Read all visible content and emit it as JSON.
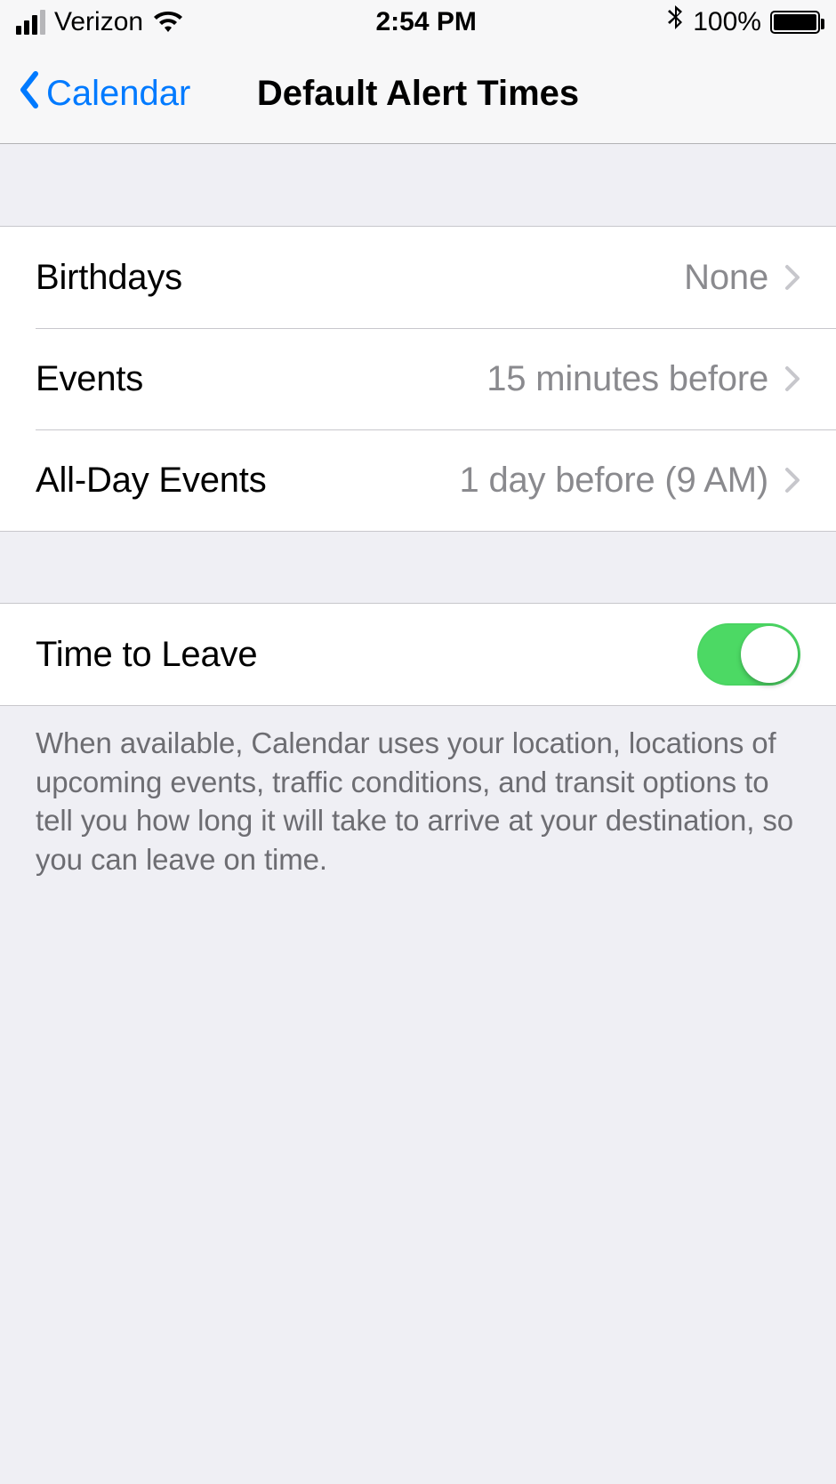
{
  "statusBar": {
    "carrier": "Verizon",
    "time": "2:54 PM",
    "battery": "100%"
  },
  "nav": {
    "back": "Calendar",
    "title": "Default Alert Times"
  },
  "alerts": {
    "birthdays": {
      "label": "Birthdays",
      "value": "None"
    },
    "events": {
      "label": "Events",
      "value": "15 minutes before"
    },
    "alldayEvents": {
      "label": "All-Day Events",
      "value": "1 day before (9 AM)"
    }
  },
  "timeToLeave": {
    "label": "Time to Leave",
    "enabled": true,
    "description": "When available, Calendar uses your location, locations of upcoming events, traffic conditions, and transit options to tell you how long it will take to arrive at your destination, so you can leave on time."
  }
}
